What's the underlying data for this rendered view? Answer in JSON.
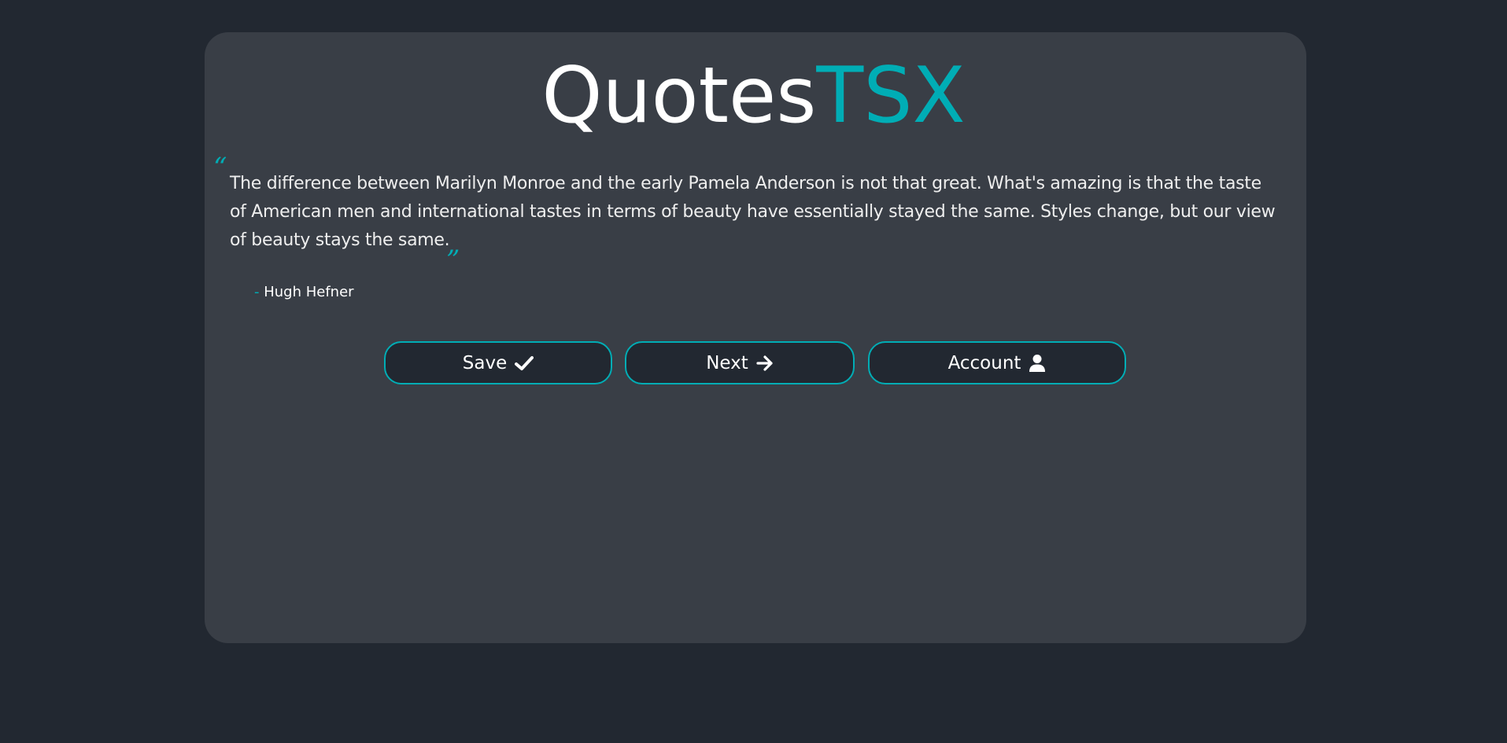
{
  "logo": {
    "part1": "Quotes",
    "part2": "TSX"
  },
  "quote": {
    "open_mark": "“",
    "text": "The difference between Marilyn Monroe and the early Pamela Anderson is not that great. What's amazing is that the taste of American men and international tastes in terms of beauty have essentially stayed the same. Styles change, but our view of beauty stays the same.",
    "close_mark": "”",
    "author_dash": "-",
    "author": "Hugh Hefner"
  },
  "buttons": {
    "save_label": "Save",
    "save_icon": "check-icon",
    "next_label": "Next",
    "next_icon": "arrow-right-icon",
    "account_label": "Account",
    "account_icon": "user-icon"
  },
  "colors": {
    "background": "#222831",
    "card": "#393e46",
    "accent": "#00adb5",
    "text": "#eeeeee"
  }
}
